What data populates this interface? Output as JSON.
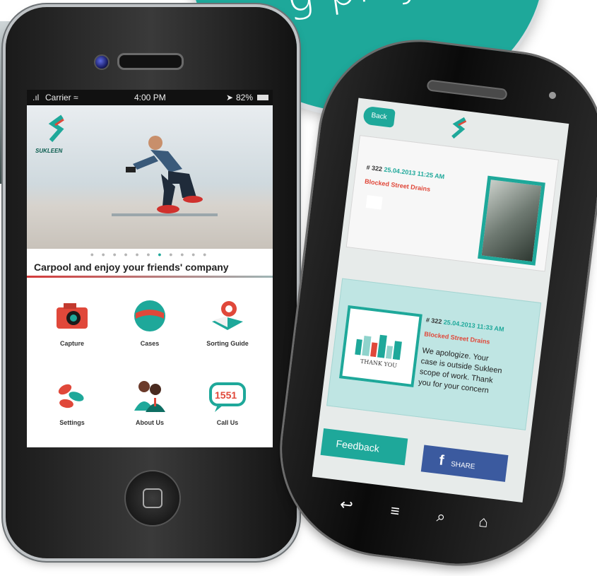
{
  "promo": {
    "text": "google play",
    "visible_text": "g play"
  },
  "iphone": {
    "status": {
      "carrier": "Carrier",
      "time": "4:00 PM",
      "battery": "82%"
    },
    "hero": {
      "logo_text": "SUKLEEN",
      "caption": "Carpool and enjoy your friends' company",
      "dots_total": 11,
      "dots_active_index": 6
    },
    "tiles": [
      {
        "label": "Capture",
        "icon": "camera-icon"
      },
      {
        "label": "Cases",
        "icon": "cases-icon"
      },
      {
        "label": "Sorting Guide",
        "icon": "sorting-guide-icon"
      },
      {
        "label": "Settings",
        "icon": "settings-icon"
      },
      {
        "label": "About Us",
        "icon": "about-us-icon"
      },
      {
        "label": "Call Us",
        "icon": "call-us-icon",
        "badge": "1551"
      }
    ]
  },
  "android": {
    "header": {
      "back_label": "Back"
    },
    "case1": {
      "id": "# 322",
      "date": "25.04.2013 11:25 AM",
      "title": "Blocked Street Drains"
    },
    "case2": {
      "id": "# 322",
      "date": "25.04.2013 11:33 AM",
      "title": "Blocked Street Drains",
      "image_label": "THANK YOU",
      "body": "We apologize. Your case is outside Sukleen scope of work. Thank you for your concern"
    },
    "actions": {
      "feedback_label": "Feedback",
      "share_label": "SHARE",
      "share_icon_text": "f"
    },
    "navbar": [
      "back-icon",
      "menu-icon",
      "search-icon",
      "home-icon"
    ]
  },
  "colors": {
    "teal": "#1ea89a",
    "red": "#e0483a",
    "facebook": "#3b5a9f"
  }
}
